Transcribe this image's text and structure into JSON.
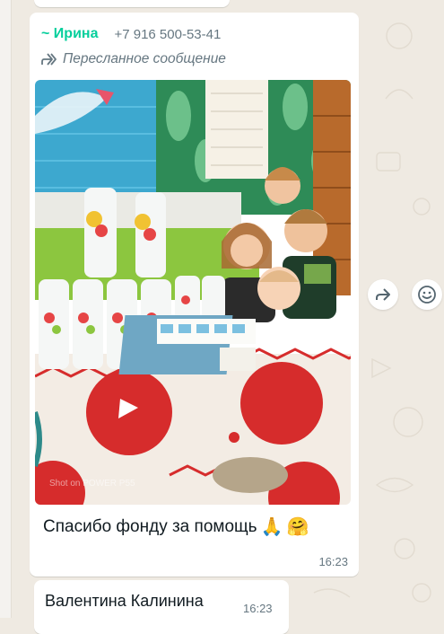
{
  "previous_message": {},
  "message": {
    "sender_name": "~ Ирина",
    "sender_phone": "+7 916 500-53-41",
    "forwarded_label": "Пересланное сообщение",
    "photo_watermark": "Shot on POWER P55",
    "caption_text": "Спасибо фонду за помощь",
    "caption_emojis": [
      "🙏",
      "🤗"
    ],
    "time": "16:23"
  },
  "next_message": {
    "sender_name": "Валентина Калинина",
    "time": "16:23"
  },
  "actions": {
    "forward_icon": "forward-icon",
    "emoji_icon": "smiley-icon"
  },
  "colors": {
    "chat_background": "#efeae2",
    "bubble": "#ffffff",
    "sender_name": "#06cf9c",
    "meta_text": "#667781"
  }
}
